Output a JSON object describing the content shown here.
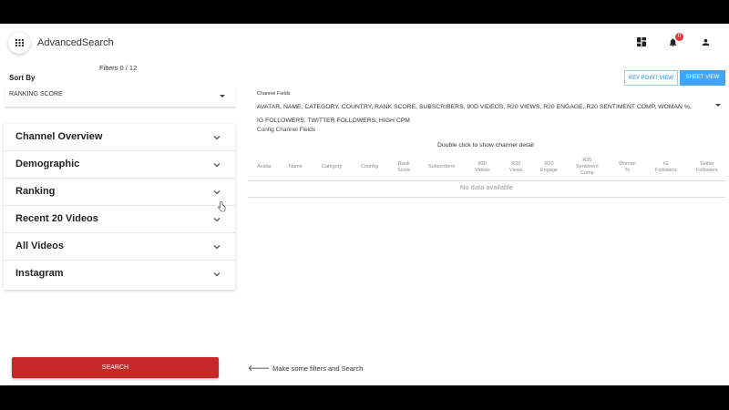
{
  "header": {
    "title": "AdvancedSearch",
    "notification_count": "0"
  },
  "left": {
    "filters_count": "Filters 0 / 12",
    "sort_by_label": "Sort By",
    "sort_value": "RANKING SCORE",
    "panels": [
      {
        "label": "Channel Overview"
      },
      {
        "label": "Demographic"
      },
      {
        "label": "Ranking"
      },
      {
        "label": "Recent 20 Videos"
      },
      {
        "label": "All Videos"
      },
      {
        "label": "Instagram"
      }
    ],
    "search_label": "SEARCH"
  },
  "right": {
    "key_point_view": "KEY POINT VIEW",
    "sheet_view": "SHEET VIEW",
    "channel_fields_label": "Channel Fields",
    "channel_fields_line1": "AVATAR, NAME, CATEGORY, COUNTRY, RANK SCORE, SUBSCRIBERS, 90D VIDEOS, R20 VIEWS, R20 ENGAGE, R20 SENTIMENT COMP, WOMAN %,",
    "channel_fields_line2": "IG FOLLOWERS, TWITTER FOLLOWERS, HIGH CPM",
    "config_label": "Config Channel Fields",
    "double_click_hint": "Double click to show channel detail",
    "columns": [
      {
        "l1": "Avatar",
        "l2": "",
        "l3": ""
      },
      {
        "l1": "Name",
        "l2": "",
        "l3": ""
      },
      {
        "l1": "Category",
        "l2": "",
        "l3": ""
      },
      {
        "l1": "Country",
        "l2": "",
        "l3": ""
      },
      {
        "l1": "Rank",
        "l2": "Score",
        "l3": ""
      },
      {
        "l1": "Subscribers",
        "l2": "",
        "l3": ""
      },
      {
        "l1": "90D",
        "l2": "Videos",
        "l3": ""
      },
      {
        "l1": "R20",
        "l2": "Views",
        "l3": ""
      },
      {
        "l1": "R20",
        "l2": "Engage",
        "l3": ""
      },
      {
        "l1": "R20",
        "l2": "Sentiment",
        "l3": "Comp"
      },
      {
        "l1": "Woman",
        "l2": "%",
        "l3": ""
      },
      {
        "l1": "IG",
        "l2": "Followers",
        "l3": ""
      },
      {
        "l1": "Twitter",
        "l2": "Followers",
        "l3": ""
      }
    ],
    "no_data": "No data available",
    "bottom_hint": "Make some filters and Search"
  },
  "icons": {
    "menu": "grid-menu-icon",
    "dashboard": "dashboard-icon",
    "notifications": "bell-icon",
    "account": "person-icon",
    "chevron": "chevron-down-icon",
    "arrow": "arrow-left-icon"
  },
  "colors": {
    "primary": "#42a5f5",
    "search_button": "#c62828",
    "badge": "#e53935"
  }
}
